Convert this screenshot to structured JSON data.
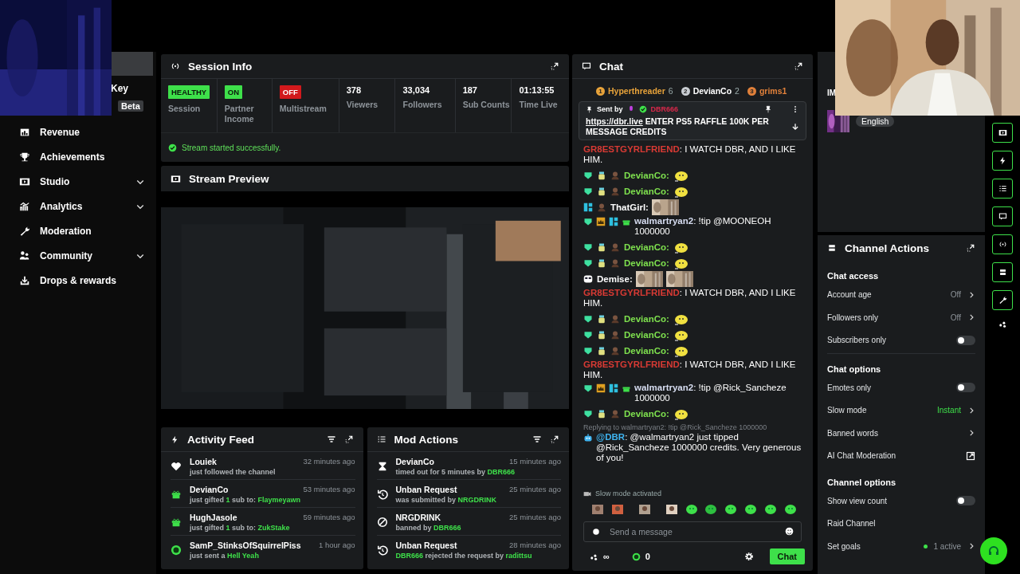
{
  "sidebar": {
    "partial_items": [
      {
        "label": "Key"
      }
    ],
    "badge": "Beta",
    "items": [
      {
        "label": "Revenue",
        "expandable": false
      },
      {
        "label": "Achievements",
        "expandable": false
      },
      {
        "label": "Studio",
        "expandable": true
      },
      {
        "label": "Analytics",
        "expandable": true
      },
      {
        "label": "Moderation",
        "expandable": false
      },
      {
        "label": "Community",
        "expandable": true
      },
      {
        "label": "Drops & rewards",
        "expandable": false
      }
    ]
  },
  "session_info": {
    "title": "Session Info",
    "stats": [
      {
        "kind": "badge",
        "value": "HEALTHY",
        "label": "Session",
        "color": "#3ee04a"
      },
      {
        "kind": "badge",
        "value": "ON",
        "label": "Partner Income",
        "color": "#3ee04a"
      },
      {
        "kind": "badge",
        "value": "OFF",
        "label": "Multistream",
        "color": "#d2191c"
      },
      {
        "kind": "number",
        "value": "378",
        "label": "Viewers"
      },
      {
        "kind": "number",
        "value": "33,034",
        "label": "Followers"
      },
      {
        "kind": "number",
        "value": "187",
        "label": "Sub Counts"
      },
      {
        "kind": "number",
        "value": "01:13:55",
        "label": "Time Live"
      }
    ],
    "message": "Stream started successfully."
  },
  "stream_preview": {
    "title": "Stream Preview"
  },
  "activity_feed": {
    "title": "Activity Feed",
    "items": [
      {
        "name": "Louiek",
        "time": "32 minutes ago",
        "parts": [
          {
            "text": "just followed the channel",
            "highlight": false
          }
        ]
      },
      {
        "name": "DevianCo",
        "time": "53 minutes ago",
        "parts": [
          {
            "text": "just gifted ",
            "highlight": false
          },
          {
            "text": "1",
            "highlight": true
          },
          {
            "text": " sub to: ",
            "highlight": false
          },
          {
            "text": "Flaymeyawn",
            "highlight": true
          }
        ]
      },
      {
        "name": "HughJasole",
        "time": "59 minutes ago",
        "parts": [
          {
            "text": "just gifted ",
            "highlight": false
          },
          {
            "text": "1",
            "highlight": true
          },
          {
            "text": " sub to: ",
            "highlight": false
          },
          {
            "text": "ZukStake",
            "highlight": true
          }
        ]
      },
      {
        "name": "SamP_StinksOfSquirrelPiss",
        "time": "1 hour ago",
        "parts": [
          {
            "text": "just sent a ",
            "highlight": false
          },
          {
            "text": "Hell Yeah",
            "highlight": true
          }
        ]
      }
    ]
  },
  "mod_actions": {
    "title": "Mod Actions",
    "items": [
      {
        "name": "DevianCo",
        "time": "15 minutes ago",
        "parts": [
          {
            "text": "timed out for 5 minutes by ",
            "highlight": false
          },
          {
            "text": "DBR666",
            "highlight": true
          }
        ]
      },
      {
        "name": "Unban Request",
        "time": "25 minutes ago",
        "parts": [
          {
            "text": "was submitted by ",
            "highlight": false
          },
          {
            "text": "NRGDRINK",
            "highlight": true
          }
        ]
      },
      {
        "name": "NRGDRINK",
        "time": "25 minutes ago",
        "parts": [
          {
            "text": "banned by ",
            "highlight": false
          },
          {
            "text": "DBR666",
            "highlight": true
          }
        ]
      },
      {
        "name": "Unban Request",
        "time": "28 minutes ago",
        "parts": [
          {
            "text": "DBR666",
            "highlight": true
          },
          {
            "text": " rejected the request by ",
            "highlight": false
          },
          {
            "text": "radittsu",
            "highlight": true
          }
        ]
      }
    ]
  },
  "chat": {
    "title": "Chat",
    "leaderboard": [
      {
        "rank": "1",
        "name": "Hyperthreader",
        "count": "6",
        "color": "#e8a33a"
      },
      {
        "rank": "2",
        "name": "DevianCo",
        "count": "2",
        "color": "#c9cdd2"
      },
      {
        "rank": "3",
        "name": "grims1",
        "color": "#e0803a"
      }
    ],
    "pinned": {
      "label": "Sent by",
      "user": "DBR666",
      "link": "https://dbr.live",
      "text": "ENTER PS5 RAFFLE 100K PER MESSAGE CREDITS"
    },
    "messages": [
      {
        "kind": "text",
        "user": "GR8ESTGYRLFRIEND",
        "color": "#d83a34",
        "text": ": I WATCH DBR, AND I LIKE HIM."
      },
      {
        "kind": "emote",
        "user": "DevianCo:",
        "color": "#7ee04e"
      },
      {
        "kind": "emote",
        "user": "DevianCo:",
        "color": "#7ee04e"
      },
      {
        "user": "ThatGirl:",
        "color": "#ffffff"
      },
      {
        "kind": "tip",
        "user": "walmartryan2",
        "color": "#d6dcf0",
        "text": ": !tip @MOONEOH 1000000"
      },
      {
        "kind": "emote",
        "user": "DevianCo:",
        "color": "#7ee04e"
      },
      {
        "kind": "emote",
        "user": "DevianCo:",
        "color": "#7ee04e"
      },
      {
        "kind": "image_pair",
        "user": "Demise:",
        "color": "#ffffff"
      },
      {
        "kind": "text",
        "user": "GR8ESTGYRLFRIEND",
        "color": "#d83a34",
        "text": ": I WATCH DBR, AND I LIKE HIM."
      },
      {
        "kind": "emote",
        "user": "DevianCo:",
        "color": "#7ee04e"
      },
      {
        "kind": "emote",
        "user": "DevianCo:",
        "color": "#7ee04e"
      },
      {
        "kind": "emote",
        "user": "DevianCo:",
        "color": "#7ee04e"
      },
      {
        "kind": "text",
        "user": "GR8ESTGYRLFRIEND",
        "color": "#d83a34",
        "text": ": I WATCH DBR, AND I LIKE HIM."
      },
      {
        "kind": "tip",
        "user": "walmartryan2",
        "color": "#d6dcf0",
        "text": ": !tip @Rick_Sancheze 1000000"
      },
      {
        "kind": "emote",
        "user": "DevianCo:",
        "color": "#7ee04e"
      },
      {
        "kind": "reply",
        "reply_to": "Replying to walmartryan2: !tip @Rick_Sancheze 1000000",
        "user": "@DBR",
        "color": "#3fb4f0",
        "text": ": @walmartryan2 just tipped @Rick_Sancheze 1000000 credits. Very generous of you!"
      }
    ],
    "notice": "Slow mode activated",
    "input": {
      "placeholder": "Send a message"
    },
    "footer": {
      "points": "∞",
      "coins": "0",
      "send": "Chat"
    }
  },
  "info_panel": {
    "title": "IM",
    "language": "English"
  },
  "channel_actions": {
    "title": "Channel Actions",
    "sections": [
      {
        "title": "Chat access",
        "rows": [
          {
            "kind": "select",
            "label": "Account age",
            "value": "Off",
            "accent": false
          },
          {
            "kind": "select",
            "label": "Followers only",
            "value": "Off",
            "accent": false
          },
          {
            "kind": "toggle",
            "label": "Subscribers only",
            "on": false
          }
        ]
      },
      {
        "title": "Chat options",
        "rows": [
          {
            "kind": "toggle",
            "label": "Emotes only",
            "on": false
          },
          {
            "kind": "select",
            "label": "Slow mode",
            "value": "Instant",
            "accent": true
          },
          {
            "kind": "select",
            "label": "Banned words"
          },
          {
            "kind": "external",
            "label": "AI Chat Moderation"
          }
        ]
      },
      {
        "title": "Channel options",
        "rows": [
          {
            "kind": "toggle",
            "label": "Show view count",
            "on": false
          },
          {
            "kind": "plain",
            "label": "Raid Channel"
          },
          {
            "kind": "status",
            "label": "Set goals",
            "value": "1 active",
            "color": "#3ee04a"
          }
        ]
      }
    ]
  }
}
